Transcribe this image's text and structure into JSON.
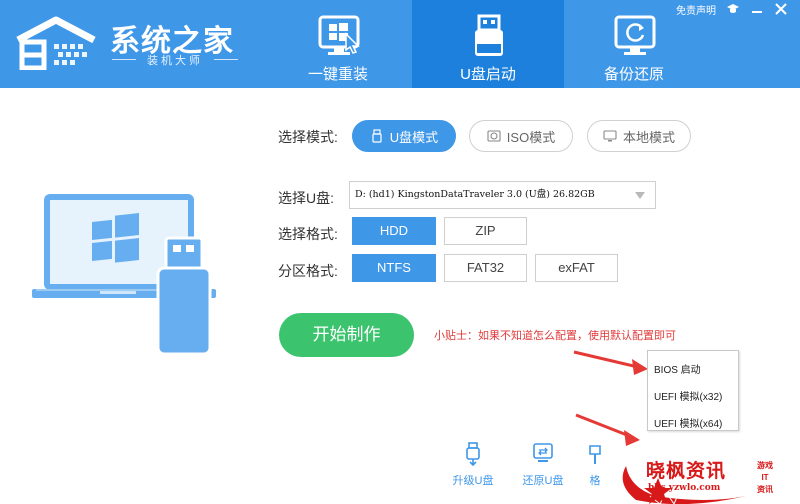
{
  "header": {
    "app_title": "系统之家",
    "app_subtitle": "装机大师",
    "disclaimer": "免责声明",
    "tabs": [
      {
        "label": "一键重装",
        "icon": "windows-cursor-icon",
        "active": false
      },
      {
        "label": "U盘启动",
        "icon": "usb-drive-icon",
        "active": true
      },
      {
        "label": "备份还原",
        "icon": "backup-restore-icon",
        "active": false
      }
    ]
  },
  "main": {
    "mode_label": "选择模式:",
    "modes": [
      {
        "label": "U盘模式",
        "icon": "usb-icon",
        "active": true
      },
      {
        "label": "ISO模式",
        "icon": "disc-icon",
        "active": false
      },
      {
        "label": "本地模式",
        "icon": "monitor-icon",
        "active": false
      }
    ],
    "disk_label": "选择U盘:",
    "disk_value": "D: (hd1) KingstonDataTraveler 3.0 (U盘) 26.82GB",
    "format_label": "选择格式:",
    "formats": [
      {
        "label": "HDD",
        "active": true
      },
      {
        "label": "ZIP",
        "active": false
      }
    ],
    "partition_label": "分区格式:",
    "partitions": [
      {
        "label": "NTFS",
        "active": true
      },
      {
        "label": "FAT32",
        "active": false
      },
      {
        "label": "exFAT",
        "active": false
      }
    ],
    "start_button": "开始制作",
    "tip": "小贴士：如果不知道怎么配置，使用默认配置即可"
  },
  "context_menu": {
    "items": [
      "BIOS 启动",
      "UEFI 模拟(x32)",
      "UEFI 模拟(x64)"
    ]
  },
  "tools": [
    {
      "label": "升级U盘",
      "icon": "usb-upgrade-icon"
    },
    {
      "label": "还原U盘",
      "icon": "usb-restore-icon"
    },
    {
      "label": "格",
      "icon": "format-icon"
    }
  ],
  "watermark": {
    "title": "晓枫资讯",
    "url": "bbs.yzwlo.com",
    "side": [
      "游戏",
      "IT",
      "资讯"
    ]
  },
  "colors": {
    "header_bg": "#3f97e8",
    "active_tab_bg": "#1e80dd",
    "accent": "#3f97e8",
    "start_button": "#3cc36e",
    "tip_text": "#e23b3b",
    "arrow": "#e53935",
    "watermark": "#d81919"
  }
}
